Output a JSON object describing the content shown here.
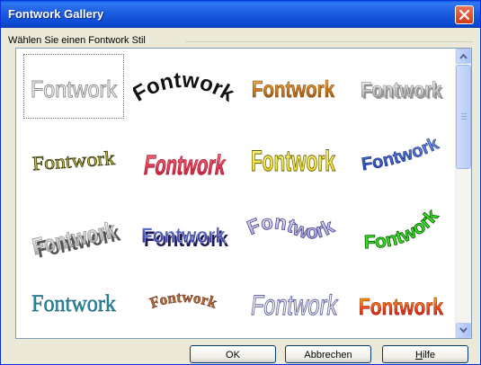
{
  "window": {
    "title": "Fontwork Gallery"
  },
  "group": {
    "label": "Wählen Sie einen Fontwork Stil"
  },
  "gallery": {
    "item_text": "Fontwork",
    "items": [
      {
        "style": "outline-gray",
        "selected": true
      },
      {
        "style": "black-arc"
      },
      {
        "style": "orange-gradient"
      },
      {
        "style": "gray-outline-bold"
      },
      {
        "style": "olive-slant"
      },
      {
        "style": "red-perspective"
      },
      {
        "style": "yellow-bulge"
      },
      {
        "style": "blue-rising"
      },
      {
        "style": "gray-3d"
      },
      {
        "style": "blue-purple-3d"
      },
      {
        "style": "lavender-wave"
      },
      {
        "style": "green-arc"
      },
      {
        "style": "teal-serif"
      },
      {
        "style": "brown-arch"
      },
      {
        "style": "outline-slant"
      },
      {
        "style": "red-yellow-gradient"
      }
    ]
  },
  "buttons": {
    "ok": "OK",
    "cancel": "Abbrechen",
    "help_first": "H",
    "help_rest": "ilfe"
  },
  "colors": {
    "title_bar": "#0a5ce6",
    "dialog_bg": "#ece9d8",
    "close_button": "#cf3b17"
  }
}
